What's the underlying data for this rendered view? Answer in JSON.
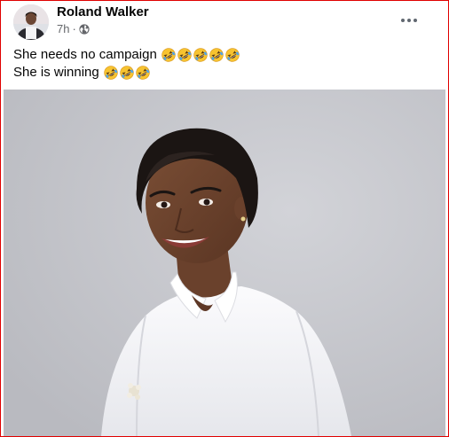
{
  "post": {
    "author": "Roland Walker",
    "timestamp": "7h",
    "separator": "·",
    "audience_icon": "globe-icon",
    "menu_icon": "more-options-icon",
    "lines": [
      {
        "text": "She needs no campaign",
        "emoji": "rolling-on-floor-laughing",
        "emoji_count": 5
      },
      {
        "text": "She is winning",
        "emoji": "rolling-on-floor-laughing",
        "emoji_count": 3
      }
    ]
  },
  "colors": {
    "frame_border": "#e00000",
    "photo_background": "#c4c5ca",
    "secondary_text": "#65676b"
  }
}
